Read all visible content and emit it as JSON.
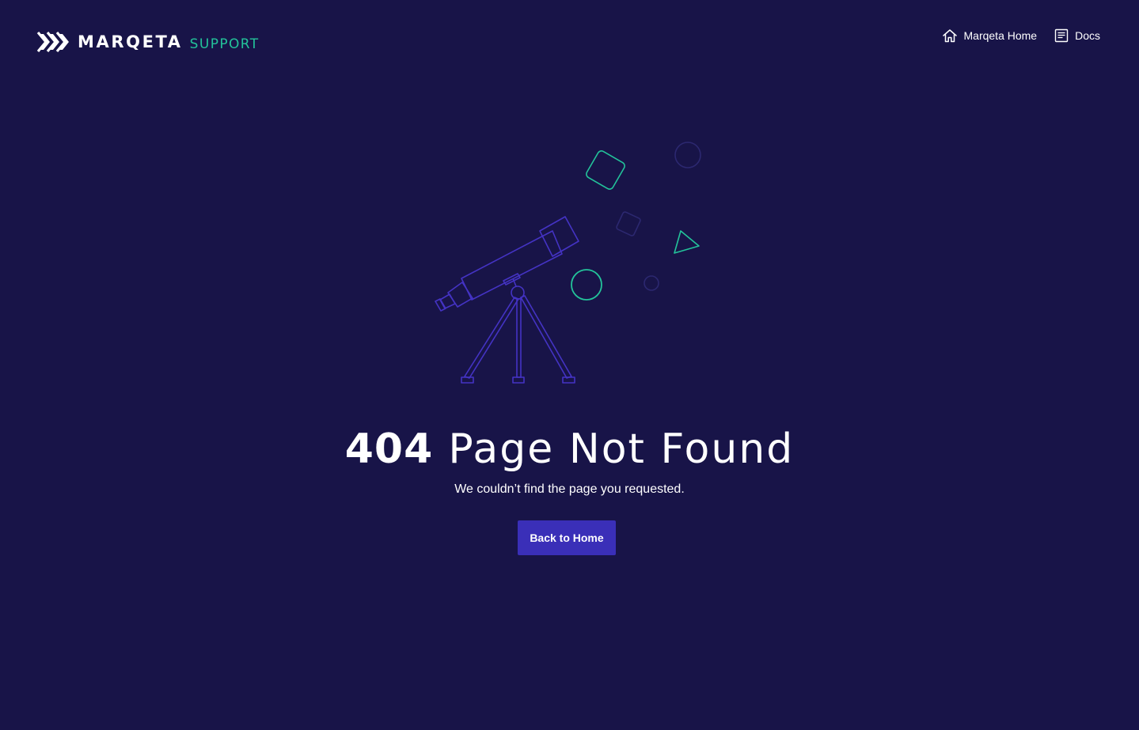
{
  "header": {
    "logo": {
      "brand": "MARQETA",
      "sub": "SUPPORT"
    },
    "nav": [
      {
        "label": "Marqeta Home",
        "icon": "home-icon"
      },
      {
        "label": "Docs",
        "icon": "document-icon"
      }
    ]
  },
  "main": {
    "error_code": "404",
    "error_message": "Page Not Found",
    "description": "We couldn’t find the page you requested.",
    "button_label": "Back to Home"
  },
  "colors": {
    "background": "#181448",
    "accent_green": "#23c39a",
    "accent_purple": "#3a2fb8",
    "text": "#ffffff"
  }
}
